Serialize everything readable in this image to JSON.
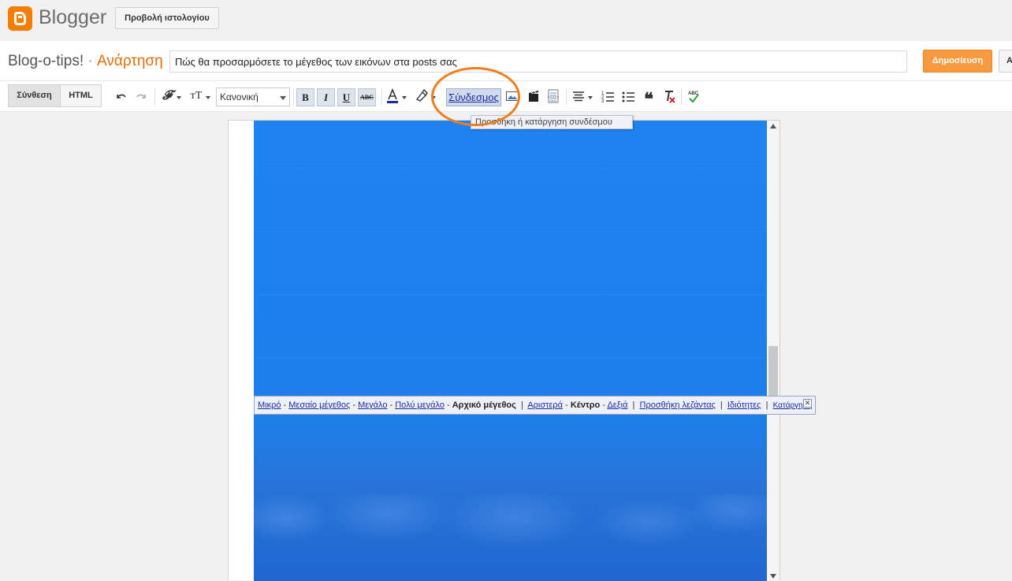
{
  "topbar": {
    "logo_text": "Blogger",
    "view_blog_label": "Προβολή ιστολογίου"
  },
  "titlebar": {
    "blog_name": "Blog-o-tips!",
    "separator": " · ",
    "section": "Ανάρτηση",
    "post_title_value": "Πώς θα προσαρμόσετε το μέγεθος των εικόνων στα posts σας",
    "publish_label": "Δημοσίευση",
    "save_label": "Α"
  },
  "toolbar": {
    "mode_compose": "Σύνθεση",
    "mode_html": "HTML",
    "format_value": "Κανονική",
    "bold": "B",
    "italic": "I",
    "underline": "U",
    "strike": "ABC",
    "link_label": "Σύνδεσμος",
    "link_tooltip": "Προσθήκη ή κατάργηση συνδέσμου"
  },
  "image_bar": {
    "small": "Μικρό",
    "medium": "Μεσαίο μέγεθος",
    "large": "Μεγάλο",
    "xlarge": "Πολύ μεγάλο",
    "original": "Αρχικό μέγεθος",
    "left": "Αριστερά",
    "center": "Κέντρο",
    "right": "Δεξιά",
    "caption": "Προσθήκη λεζάντας",
    "properties": "Ιδιότητες",
    "remove": "Κατάργηση",
    "dash": " - ",
    "pipe": "  |  "
  },
  "colors": {
    "brand": "#f57d00",
    "publish": "#f79a3e",
    "highlight_ring": "#f07d1e",
    "image_blue": "#1e83f0"
  }
}
